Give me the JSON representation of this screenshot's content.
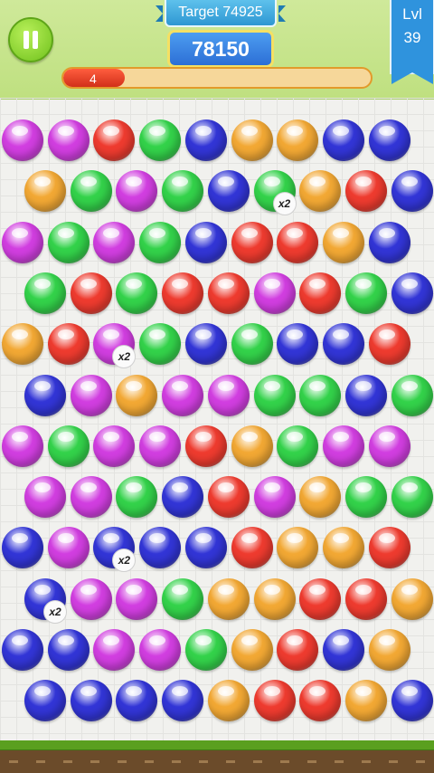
{
  "header": {
    "target_label": "Target 74925",
    "score": "78150",
    "progress_label": "4",
    "progress_fraction": 0.2,
    "level_label": "Lvl",
    "level_number": "39"
  },
  "colors": {
    "magenta": "#d13ee0",
    "green": "#33d24a",
    "red": "#ee3b2f",
    "blue": "#3235d6",
    "orange": "#f2a834"
  },
  "board": {
    "rows": [
      [
        "magenta",
        "magenta",
        "red",
        "green",
        "blue",
        "orange",
        "orange",
        "blue",
        "blue"
      ],
      [
        "orange",
        "green",
        "magenta",
        "green",
        "blue",
        "green",
        "orange",
        "red",
        "blue"
      ],
      [
        "magenta",
        "green",
        "magenta",
        "green",
        "blue",
        "red",
        "red",
        "orange",
        "blue"
      ],
      [
        "green",
        "red",
        "green",
        "red",
        "red",
        "magenta",
        "red",
        "green",
        "blue"
      ],
      [
        "orange",
        "red",
        "magenta",
        "green",
        "blue",
        "green",
        "blue",
        "blue",
        "red"
      ],
      [
        "blue",
        "magenta",
        "orange",
        "magenta",
        "magenta",
        "green",
        "green",
        "blue",
        "green"
      ],
      [
        "magenta",
        "green",
        "magenta",
        "magenta",
        "red",
        "orange",
        "green",
        "magenta",
        "magenta"
      ],
      [
        "magenta",
        "magenta",
        "green",
        "blue",
        "red",
        "magenta",
        "orange",
        "green",
        "green"
      ],
      [
        "blue",
        "magenta",
        "blue",
        "blue",
        "blue",
        "red",
        "orange",
        "orange",
        "red"
      ],
      [
        "blue",
        "magenta",
        "magenta",
        "green",
        "orange",
        "orange",
        "red",
        "red",
        "orange"
      ],
      [
        "blue",
        "blue",
        "magenta",
        "magenta",
        "green",
        "orange",
        "red",
        "blue",
        "orange"
      ],
      [
        "blue",
        "blue",
        "blue",
        "blue",
        "orange",
        "red",
        "red",
        "orange",
        "blue"
      ]
    ],
    "badges": [
      {
        "row": 1,
        "col": 5,
        "text": "x2"
      },
      {
        "row": 4,
        "col": 2,
        "text": "x2"
      },
      {
        "row": 8,
        "col": 2,
        "text": "x2"
      },
      {
        "row": 9,
        "col": 0,
        "text": "x2"
      }
    ]
  }
}
